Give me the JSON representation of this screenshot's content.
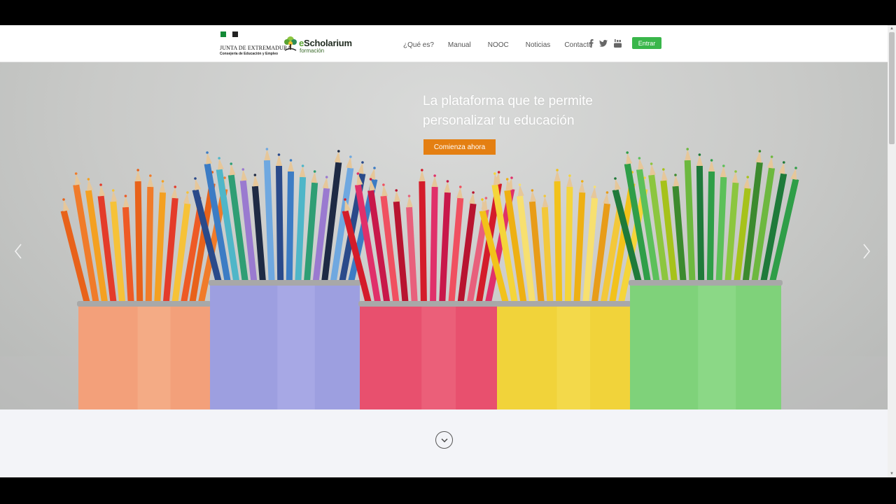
{
  "header": {
    "junta": {
      "name": "JUNTA DE EXTREMADURA",
      "department": "Consejería de Educación y Empleo"
    },
    "escholarium": {
      "name_prefix": "e",
      "name_rest": "Scholarium",
      "subtitle": "formación"
    },
    "nav": [
      {
        "label": "¿Qué es?"
      },
      {
        "label": "Manual"
      },
      {
        "label": "NOOC"
      },
      {
        "label": "Noticias"
      },
      {
        "label": "Contacto"
      }
    ],
    "social_icons": [
      "facebook-icon",
      "twitter-icon",
      "youtube-icon"
    ],
    "login_label": "Entrar"
  },
  "hero": {
    "title_line1": "La plataforma que te permite",
    "title_line2": "personalizar tu educación",
    "cta_label": "Comienza ahora"
  },
  "recorder": {
    "icons": [
      "more-icon",
      "camera-icon",
      "close-icon",
      "pause-icon",
      "check-icon"
    ]
  },
  "colors": {
    "brand_green": "#39b64a",
    "cta_orange": "#e47f12",
    "junta_green": "#138a36"
  }
}
